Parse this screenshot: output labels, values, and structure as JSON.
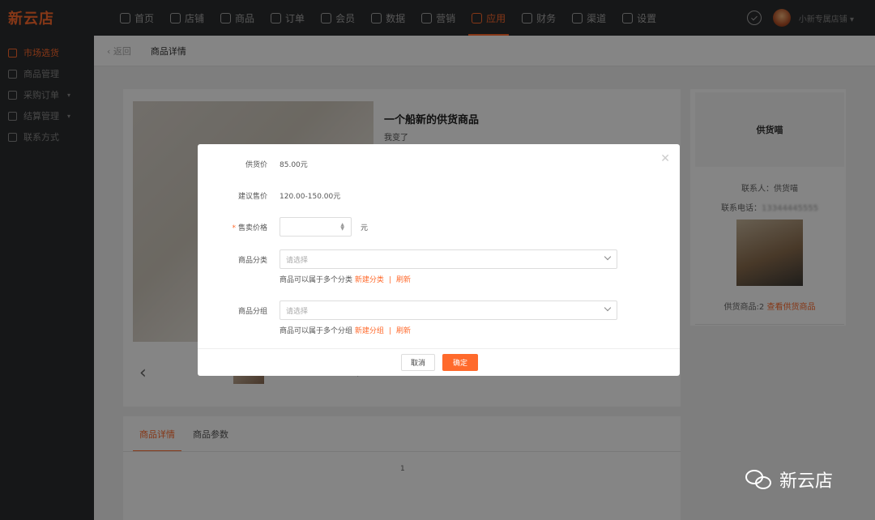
{
  "app": {
    "logo": "新云店"
  },
  "nav": [
    {
      "label": "首页",
      "icon": "home-icon"
    },
    {
      "label": "店铺",
      "icon": "store-icon"
    },
    {
      "label": "商品",
      "icon": "goods-icon"
    },
    {
      "label": "订单",
      "icon": "order-icon"
    },
    {
      "label": "会员",
      "icon": "member-icon"
    },
    {
      "label": "数据",
      "icon": "data-icon"
    },
    {
      "label": "营销",
      "icon": "marketing-icon"
    },
    {
      "label": "应用",
      "icon": "app-icon"
    },
    {
      "label": "财务",
      "icon": "finance-icon"
    },
    {
      "label": "渠道",
      "icon": "channel-icon"
    },
    {
      "label": "设置",
      "icon": "settings-icon"
    }
  ],
  "nav_active_index": 7,
  "user": {
    "name": "小新专属店铺 ▾"
  },
  "sidebar": [
    {
      "label": "市场选货",
      "icon": "market-icon"
    },
    {
      "label": "商品管理",
      "icon": "goods-manage-icon"
    },
    {
      "label": "采购订单",
      "icon": "purchase-icon"
    },
    {
      "label": "结算管理",
      "icon": "settle-icon"
    },
    {
      "label": "联系方式",
      "icon": "contact-icon"
    }
  ],
  "page": {
    "back": "返回",
    "title": "商品详情"
  },
  "product": {
    "title": "一个船新的供货商品",
    "subtitle": "我变了"
  },
  "supplier": {
    "name": "供货喵",
    "contact": "联系人：供货喵",
    "phone_label": "联系电话：",
    "phone": "13344445555",
    "count_prefix": "供货商品:2",
    "count_link": "查看供货商品"
  },
  "tabs": [
    {
      "label": "商品详情"
    },
    {
      "label": "商品参数"
    }
  ],
  "pagenum": "1",
  "modal": {
    "supply_price_label": "供货价",
    "supply_price": "85.00元",
    "suggest_price_label": "建议售价",
    "suggest_price": "120.00-150.00元",
    "sale_price_label": "售卖价格",
    "sale_price_required": "*",
    "sale_price_unit": "元",
    "category_label": "商品分类",
    "category_placeholder": "请选择",
    "category_hint": "商品可以属于多个分类",
    "category_new": "新建分类",
    "refresh": "刷新",
    "sep": "|",
    "group_label": "商品分组",
    "group_placeholder": "请选择",
    "group_hint": "商品可以属于多个分组",
    "group_new": "新建分组",
    "cancel": "取消",
    "ok": "确定"
  },
  "watermark": {
    "text": "新云店"
  },
  "colors": {
    "accent": "#ff6a2c",
    "topbar": "#2b2c2e"
  }
}
